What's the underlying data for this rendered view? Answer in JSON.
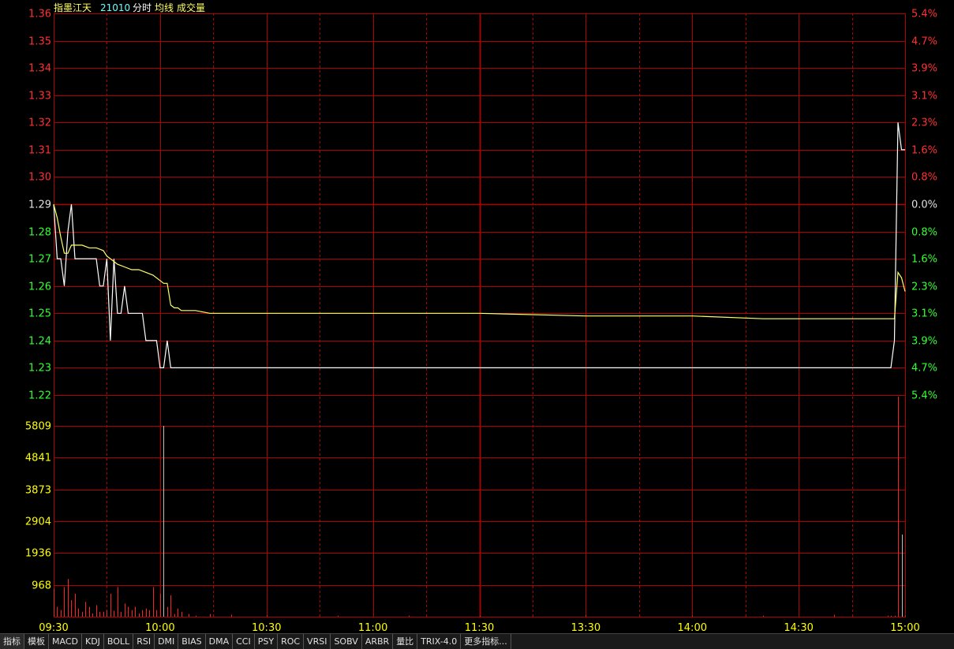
{
  "header": {
    "name": "指墨江天",
    "code": "21010",
    "labels": [
      "分时",
      "均线",
      "成交量"
    ]
  },
  "tabs": [
    "指标",
    "模板",
    "MACD",
    "KDJ",
    "BOLL",
    "RSI",
    "DMI",
    "BIAS",
    "DMA",
    "CCI",
    "PSY",
    "ROC",
    "VRSI",
    "SOBV",
    "ARBR",
    "量比",
    "TRIX-4.0",
    "更多指标..."
  ],
  "colors": {
    "grid": "#b00000",
    "price_line": "#ffffff",
    "avg_line": "#ffff66",
    "volume_bar": "#ff2020",
    "volume_bar_last": "#c0c0c0",
    "price_label": "#ff3030",
    "pct_up": "#ff3030",
    "pct_down": "#33ff33",
    "vol_label": "#ffff00",
    "time_label": "#ffff00"
  },
  "chart_data": [
    {
      "type": "line",
      "title": "",
      "xlabel": "",
      "ylabel": "",
      "x_ticks": [
        "09:30",
        "10:00",
        "10:30",
        "11:00",
        "11:30",
        "13:30",
        "14:00",
        "14:30",
        "15:00"
      ],
      "y_ticks": [
        1.36,
        1.35,
        1.34,
        1.33,
        1.32,
        1.31,
        1.3,
        1.29,
        1.28,
        1.27,
        1.26,
        1.25,
        1.24,
        1.23,
        1.22
      ],
      "y_tick_labels": [
        "1.36",
        "1.35",
        "1.34",
        "1.33",
        "1.32",
        "1.31",
        "1.30",
        "1.29",
        "1.28",
        "1.27",
        "1.26",
        "1.25",
        "1.24",
        "1.23",
        "1.22"
      ],
      "pct_tick_labels": [
        "5.4%",
        "4.7%",
        "3.9%",
        "3.1%",
        "2.3%",
        "1.6%",
        "0.8%",
        "0.0%",
        "0.8%",
        "1.6%",
        "2.3%",
        "3.1%",
        "3.9%",
        "4.7%",
        "5.4%"
      ],
      "ylim": [
        1.22,
        1.36
      ],
      "xlim_minutes": [
        0,
        240
      ],
      "prev_close": 1.29,
      "grid": true,
      "series": [
        {
          "name": "分时",
          "x_minutes": [
            0,
            1,
            2,
            3,
            4,
            5,
            6,
            7,
            8,
            9,
            10,
            11,
            12,
            13,
            14,
            15,
            16,
            17,
            18,
            19,
            20,
            21,
            22,
            23,
            24,
            25,
            26,
            27,
            28,
            29,
            30,
            31,
            32,
            33,
            34,
            35,
            36,
            220,
            236,
            237,
            238,
            239,
            240
          ],
          "y": [
            1.29,
            1.27,
            1.27,
            1.26,
            1.28,
            1.29,
            1.27,
            1.27,
            1.27,
            1.27,
            1.27,
            1.27,
            1.27,
            1.26,
            1.26,
            1.27,
            1.24,
            1.27,
            1.25,
            1.25,
            1.26,
            1.25,
            1.25,
            1.25,
            1.25,
            1.25,
            1.24,
            1.24,
            1.24,
            1.24,
            1.23,
            1.23,
            1.24,
            1.23,
            1.23,
            1.23,
            1.23,
            1.23,
            1.23,
            1.24,
            1.32,
            1.31,
            1.31
          ]
        },
        {
          "name": "均线",
          "x_minutes": [
            0,
            1,
            2,
            3,
            4,
            5,
            6,
            8,
            10,
            12,
            14,
            15,
            16,
            17,
            18,
            20,
            22,
            24,
            26,
            28,
            30,
            31,
            32,
            33,
            34,
            35,
            36,
            40,
            44,
            50,
            60,
            80,
            100,
            120,
            150,
            180,
            200,
            220,
            236,
            237,
            238,
            239,
            240
          ],
          "y": [
            1.29,
            1.285,
            1.278,
            1.272,
            1.272,
            1.275,
            1.275,
            1.275,
            1.274,
            1.274,
            1.273,
            1.271,
            1.27,
            1.269,
            1.268,
            1.267,
            1.266,
            1.266,
            1.265,
            1.264,
            1.262,
            1.261,
            1.261,
            1.253,
            1.252,
            1.252,
            1.251,
            1.251,
            1.25,
            1.25,
            1.25,
            1.25,
            1.25,
            1.25,
            1.249,
            1.249,
            1.248,
            1.248,
            1.248,
            1.248,
            1.265,
            1.263,
            1.258
          ]
        }
      ]
    },
    {
      "type": "bar",
      "title": "",
      "y_tick_labels": [
        "5809",
        "4841",
        "3873",
        "2904",
        "1936",
        "968"
      ],
      "y_ticks": [
        5809,
        4841,
        3873,
        2904,
        1936,
        968
      ],
      "ylim": [
        0,
        5809
      ],
      "series": [
        {
          "name": "成交量",
          "x_minutes": [
            0,
            1,
            2,
            3,
            4,
            5,
            6,
            7,
            8,
            9,
            10,
            11,
            12,
            13,
            14,
            15,
            16,
            17,
            18,
            19,
            20,
            21,
            22,
            23,
            24,
            25,
            26,
            27,
            28,
            29,
            30,
            31,
            32,
            33,
            34,
            35,
            36,
            38,
            40,
            44,
            50,
            60,
            80,
            100,
            120,
            150,
            180,
            200,
            220,
            235,
            236,
            237,
            238,
            239,
            240
          ],
          "values": [
            850,
            300,
            200,
            900,
            1150,
            500,
            700,
            250,
            150,
            450,
            300,
            100,
            350,
            150,
            150,
            200,
            700,
            180,
            900,
            150,
            400,
            300,
            200,
            300,
            100,
            200,
            250,
            200,
            900,
            200,
            700,
            5809,
            300,
            650,
            80,
            250,
            150,
            80,
            30,
            80,
            60,
            40,
            30,
            30,
            30,
            40,
            30,
            30,
            60,
            30,
            30,
            30,
            6700,
            2500,
            30
          ]
        }
      ]
    }
  ]
}
